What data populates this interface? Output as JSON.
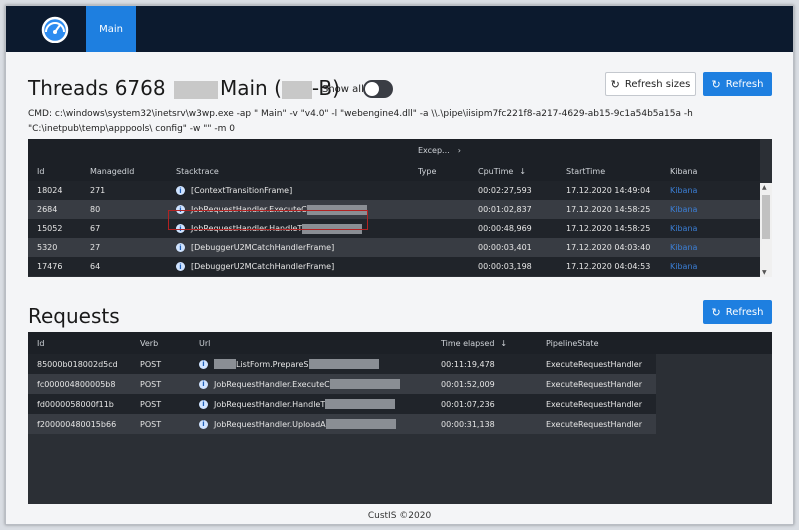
{
  "navbar": {
    "logo_icon": "speedometer-icon",
    "tab_main": "Main"
  },
  "threads": {
    "title_prefix": "Threads 6768",
    "title_mid": "Main (",
    "title_suffix": "-B)",
    "show_all_label": "Show all",
    "show_all_on": false,
    "refresh_sizes_label": "Refresh sizes",
    "refresh_label": "Refresh",
    "cmd_line1": "CMD: c:\\windows\\system32\\inetsrv\\w3wp.exe -ap \"        Main\" -v \"v4.0\" -l \"webengine4.dll\" -a \\\\.\\pipe\\iisipm7fc221f8-a217-4629-ab15-9c1a54b5a15a -h",
    "cmd_line2": "\"C:\\inetpub\\temp\\apppools\\                              config\" -w \"\" -m 0",
    "group_header": "Excep...",
    "columns": [
      "Id",
      "ManagedId",
      "Stacktrace",
      "Type",
      "CpuTime",
      "StartTime",
      "Kibana"
    ],
    "rows": [
      {
        "id": "18024",
        "managed": "271",
        "stack": "[ContextTransitionFrame]",
        "type": "",
        "cpu": "00:02:27,593",
        "start": "17.12.2020 14:49:04",
        "kibana": "Kibana"
      },
      {
        "id": "2684",
        "managed": "80",
        "stack": "JobRequestHandler.ExecuteC",
        "type": "",
        "cpu": "00:01:02,837",
        "start": "17.12.2020 14:58:25",
        "kibana": "Kibana"
      },
      {
        "id": "15052",
        "managed": "67",
        "stack": "JobRequestHandler.HandleT",
        "type": "",
        "cpu": "00:00:48,969",
        "start": "17.12.2020 14:58:25",
        "kibana": "Kibana"
      },
      {
        "id": "5320",
        "managed": "27",
        "stack": "[DebuggerU2MCatchHandlerFrame]",
        "type": "",
        "cpu": "00:00:03,401",
        "start": "17.12.2020 04:03:40",
        "kibana": "Kibana"
      },
      {
        "id": "17476",
        "managed": "64",
        "stack": "[DebuggerU2MCatchHandlerFrame]",
        "type": "",
        "cpu": "00:00:03,198",
        "start": "17.12.2020 04:04:53",
        "kibana": "Kibana"
      }
    ]
  },
  "requests": {
    "title": "Requests",
    "refresh_label": "Refresh",
    "columns": [
      "Id",
      "Verb",
      "Url",
      "Time elapsed",
      "PipelineState"
    ],
    "rows": [
      {
        "id": "85000b018002d5cd",
        "verb": "POST",
        "url": "ListForm.PrepareS",
        "time": "00:11:19,478",
        "state": "ExecuteRequestHandler"
      },
      {
        "id": "fc000004800005b8",
        "verb": "POST",
        "url": "JobRequestHandler.ExecuteC",
        "time": "00:01:52,009",
        "state": "ExecuteRequestHandler"
      },
      {
        "id": "fd0000058000f11b",
        "verb": "POST",
        "url": "JobRequestHandler.HandleT",
        "time": "00:01:07,236",
        "state": "ExecuteRequestHandler"
      },
      {
        "id": "f200000480015b66",
        "verb": "POST",
        "url": "JobRequestHandler.UploadA",
        "time": "00:00:31,138",
        "state": "ExecuteRequestHandler"
      }
    ]
  },
  "footer": "CustIS ©2020"
}
